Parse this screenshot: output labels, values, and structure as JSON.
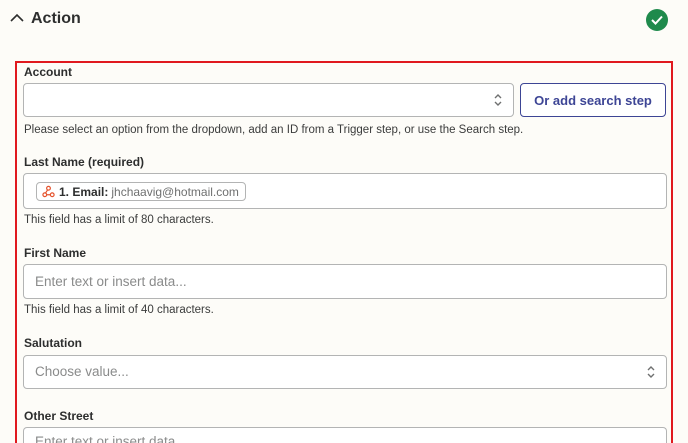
{
  "section": {
    "title": "Action",
    "status_color": "#1f8a4c"
  },
  "highlight_color": "#e0191f",
  "fields": {
    "account": {
      "label": "Account",
      "value": "",
      "search_button": "Or add search step",
      "help": "Please select an option from the dropdown, add an ID from a Trigger step, or use the Search step."
    },
    "last_name": {
      "label": "Last Name (required)",
      "pill_key": "1. Email:",
      "pill_value": "jhchaavig@hotmail.com",
      "pill_icon": "webhook-icon",
      "help": "This field has a limit of 80 characters."
    },
    "first_name": {
      "label": "First Name",
      "placeholder": "Enter text or insert data...",
      "help": "This field has a limit of 40 characters."
    },
    "salutation": {
      "label": "Salutation",
      "placeholder": "Choose value..."
    },
    "other_street": {
      "label": "Other Street",
      "placeholder": "Enter text or insert data..."
    }
  }
}
